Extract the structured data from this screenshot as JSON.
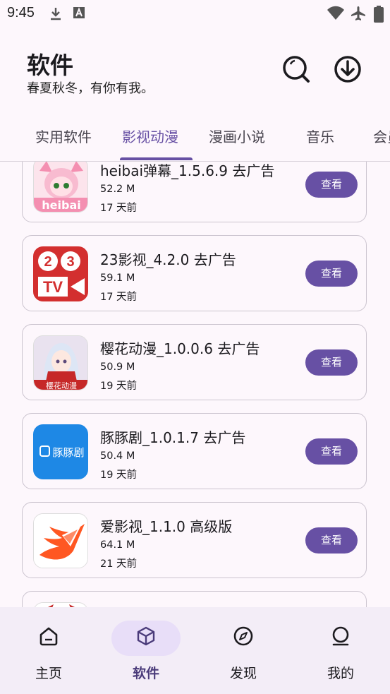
{
  "status_bar": {
    "time": "9:45",
    "icons": [
      "download-icon",
      "font-a-icon",
      "wifi-icon",
      "airplane-icon",
      "battery-icon"
    ]
  },
  "header": {
    "title": "软件",
    "subtitle": "春夏秋冬，有你有我。",
    "actions": [
      "search-icon",
      "download-circle-icon"
    ]
  },
  "tabs": [
    {
      "label": "实用软件",
      "active": false
    },
    {
      "label": "影视动漫",
      "active": true
    },
    {
      "label": "漫画小说",
      "active": false
    },
    {
      "label": "音乐",
      "active": false
    },
    {
      "label": "会员",
      "active": false
    }
  ],
  "apps": [
    {
      "name": "heibai弹幕_1.5.6.9 去广告",
      "size": "52.2 M",
      "time": "17 天前",
      "button": "查看",
      "icon_text": "heibai",
      "accent": "#f48fb1"
    },
    {
      "name": "23影视_4.2.0 去广告",
      "size": "59.1 M",
      "time": "17 天前",
      "button": "查看",
      "icon_text": "23 TV",
      "accent": "#d32f2f"
    },
    {
      "name": "樱花动漫_1.0.0.6 去广告",
      "size": "50.9 M",
      "time": "19 天前",
      "button": "查看",
      "icon_text": "樱花动漫",
      "accent": "#c62828"
    },
    {
      "name": "豚豚剧_1.0.1.7 去广告",
      "size": "50.4 M",
      "time": "19 天前",
      "button": "查看",
      "icon_text": "豚豚剧",
      "accent": "#1e88e5"
    },
    {
      "name": "爱影视_1.1.0 高级版",
      "size": "64.1 M",
      "time": "21 天前",
      "button": "查看",
      "icon_text": "",
      "accent": "#ff5722"
    }
  ],
  "bottom_nav": [
    {
      "label": "主页",
      "icon": "home-icon",
      "active": false
    },
    {
      "label": "软件",
      "icon": "box-icon",
      "active": true
    },
    {
      "label": "发现",
      "icon": "compass-icon",
      "active": false
    },
    {
      "label": "我的",
      "icon": "person-icon",
      "active": false
    }
  ],
  "colors": {
    "primary": "#6750a4",
    "background": "#fdf7fc",
    "nav_bg": "#f3edf7",
    "pill": "#e8def8"
  }
}
